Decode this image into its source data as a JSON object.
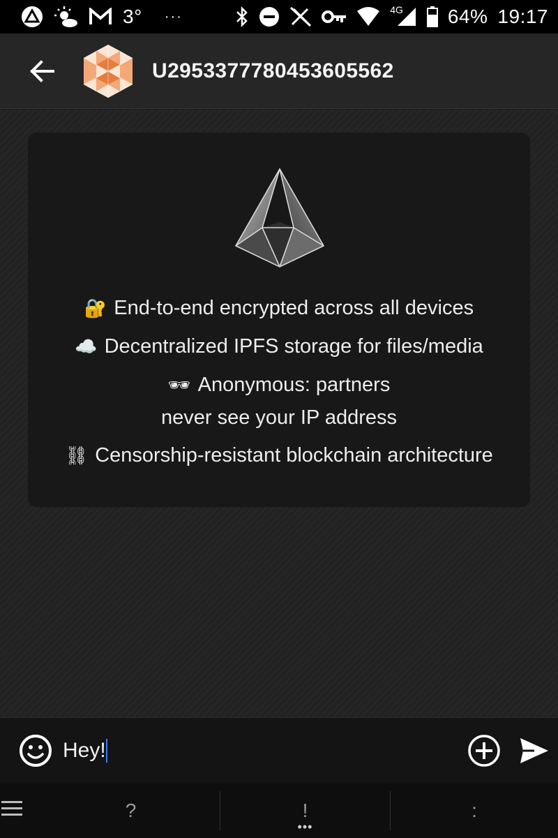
{
  "status_bar": {
    "temperature": "3°",
    "overflow": "···",
    "network": "4G",
    "battery": "64%",
    "time": "19:17"
  },
  "header": {
    "title": "U2953377780453605562"
  },
  "welcome_card": {
    "features": [
      {
        "emoji": "🔐",
        "text": "End-to-end encrypted across all devices"
      },
      {
        "emoji": "☁️",
        "text": "Decentralized IPFS storage for files/media"
      },
      {
        "emoji": "🕶",
        "text": "Anonymous: partners",
        "text_line2": "never see your IP address"
      },
      {
        "emoji": "⛓",
        "text": "Censorship-resistant blockchain architecture"
      }
    ]
  },
  "composer": {
    "value": "Hey!"
  },
  "keyboard_bar": {
    "key_1": "?",
    "key_2": "!",
    "key_2_extra": "•••",
    "key_3": ":"
  },
  "colors": {
    "background": "#222222",
    "card": "#181818",
    "avatar_accent": "#e8925c",
    "caret": "#3a7bff"
  }
}
